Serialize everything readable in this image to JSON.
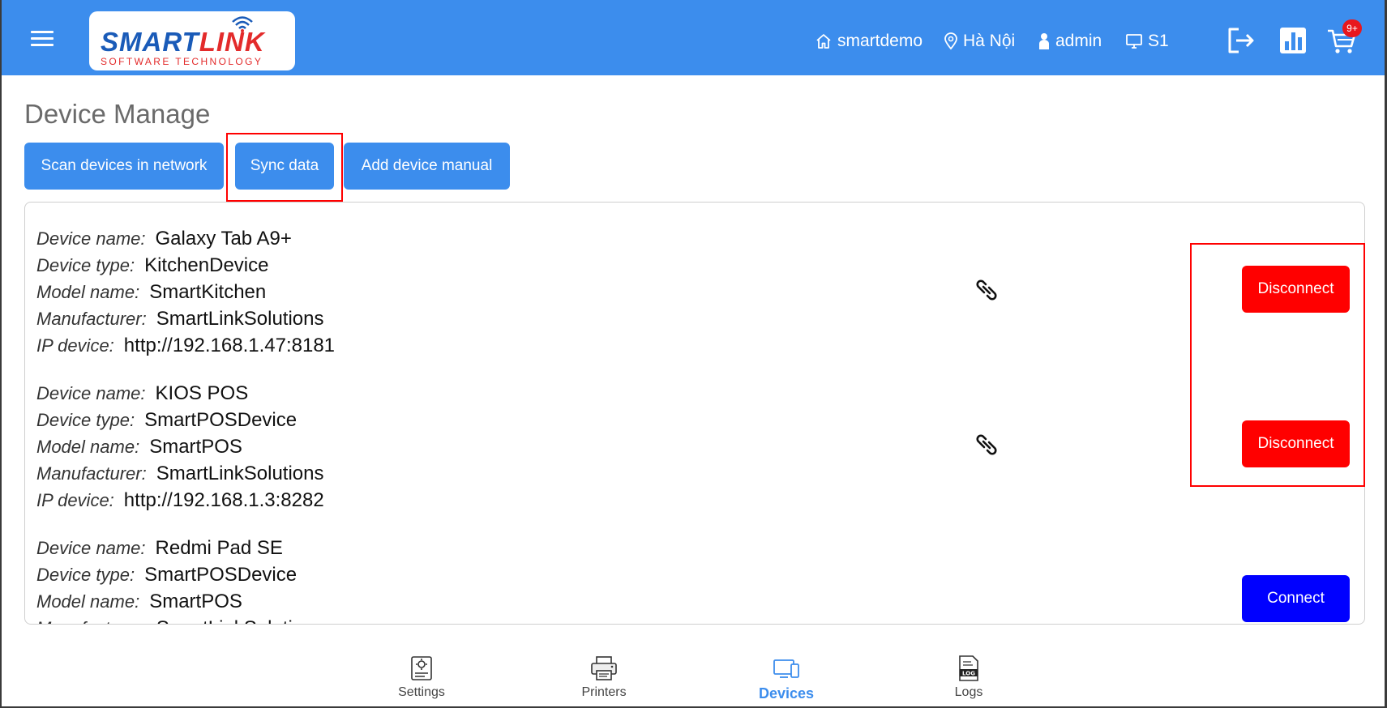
{
  "header": {
    "logo_text_part1": "SMART",
    "logo_text_part2": "LINK",
    "logo_subtitle": "SOFTWARE TECHNOLOGY",
    "store": "smartdemo",
    "location": "Hà Nội",
    "user": "admin",
    "station": "S1",
    "cart_badge": "9+",
    "colors": {
      "bar": "#3c8ded",
      "badge": "#e8171d"
    }
  },
  "page": {
    "title": "Device Manage"
  },
  "toolbar": {
    "scan_label": "Scan devices in network",
    "sync_label": "Sync data",
    "add_label": "Add device manual"
  },
  "labels": {
    "device_name": "Device name:",
    "device_type": "Device type:",
    "model_name": "Model name:",
    "manufacturer": "Manufacturer:",
    "ip_device": "IP device:"
  },
  "devices": [
    {
      "name": "Galaxy Tab A9+",
      "type": "KitchenDevice",
      "model": "SmartKitchen",
      "manufacturer": "SmartLinkSolutions",
      "ip": "http://192.168.1.47:8181",
      "linked_icon": "link-icon",
      "action": "Disconnect",
      "action_color": "#ff0000"
    },
    {
      "name": "KIOS POS",
      "type": "SmartPOSDevice",
      "model": "SmartPOS",
      "manufacturer": "SmartLinkSolutions",
      "ip": "http://192.168.1.3:8282",
      "linked_icon": "link-icon",
      "action": "Disconnect",
      "action_color": "#ff0000"
    },
    {
      "name": "Redmi Pad SE",
      "type": "SmartPOSDevice",
      "model": "SmartPOS",
      "manufacturer": "SmartLinkSolutions",
      "action": "Connect",
      "action_color": "#0000ff"
    }
  ],
  "bottom_nav": {
    "items": [
      {
        "label": "Settings",
        "icon": "settings-doc-icon"
      },
      {
        "label": "Printers",
        "icon": "printer-icon"
      },
      {
        "label": "Devices",
        "icon": "devices-icon",
        "active": true
      },
      {
        "label": "Logs",
        "icon": "log-file-icon"
      }
    ],
    "active_color": "#3c8ded"
  }
}
